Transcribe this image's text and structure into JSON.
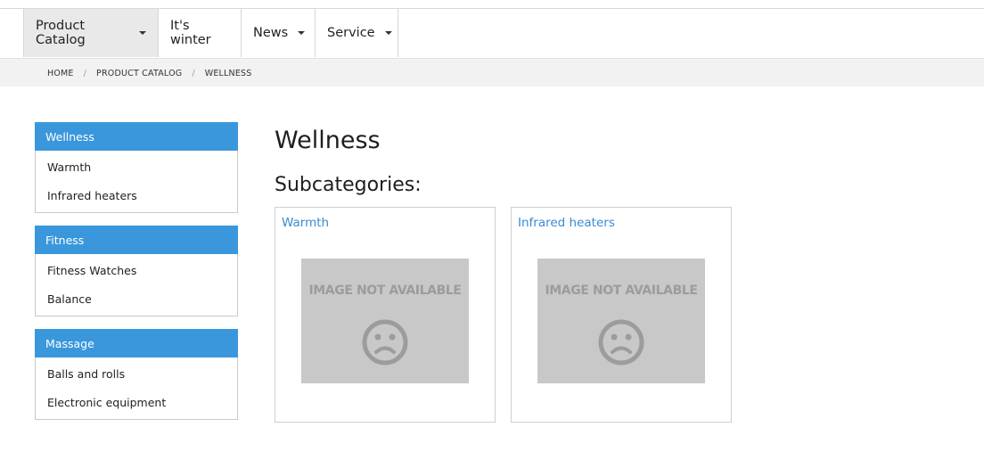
{
  "nav": {
    "items": [
      {
        "label": "Product Catalog",
        "has_dropdown": true,
        "active": true
      },
      {
        "label": "It's winter",
        "has_dropdown": false,
        "active": false
      },
      {
        "label": "News",
        "has_dropdown": true,
        "active": false
      },
      {
        "label": "Service",
        "has_dropdown": true,
        "active": false
      }
    ]
  },
  "breadcrumb": {
    "items": [
      "HOME",
      "PRODUCT CATALOG",
      "WELLNESS"
    ],
    "separator": "/"
  },
  "sidebar": {
    "groups": [
      {
        "title": "Wellness",
        "links": [
          "Warmth",
          "Infrared heaters"
        ]
      },
      {
        "title": "Fitness",
        "links": [
          "Fitness Watches",
          "Balance"
        ]
      },
      {
        "title": "Massage",
        "links": [
          "Balls and rolls",
          "Electronic equipment"
        ]
      }
    ]
  },
  "main": {
    "title": "Wellness",
    "subtitle": "Subcategories:",
    "cards": [
      {
        "label": "Warmth",
        "image_text": "IMAGE NOT AVAILABLE",
        "image_icon": "sad-face-icon"
      },
      {
        "label": "Infrared heaters",
        "image_text": "IMAGE NOT AVAILABLE",
        "image_icon": "sad-face-icon"
      }
    ]
  },
  "colors": {
    "accent": "#3a97dc",
    "link": "#3a8ad1",
    "placeholder_bg": "#c8c8c8",
    "placeholder_fg": "#9c9c9c"
  }
}
